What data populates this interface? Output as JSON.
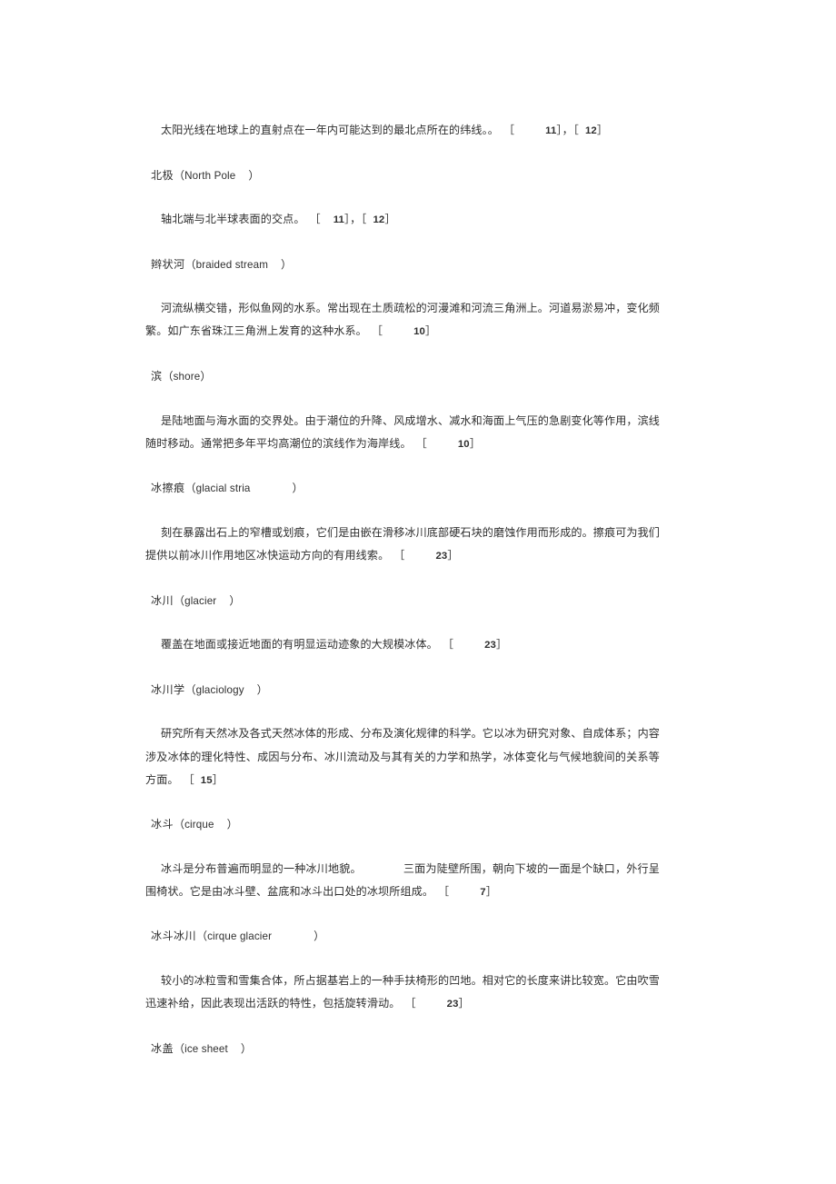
{
  "document": {
    "type": "glossary-page",
    "language": "zh-CN",
    "background_color": "#ffffff",
    "text_color": "#2f2f2f"
  },
  "entries": [
    {
      "id": "entry-tropic-of-cancer-definition",
      "kind": "definition-only",
      "definition": "太阳光线在地球上的直射点在一年内可能达到的最北点所在的纬线。。",
      "citations": [
        "11",
        "12"
      ]
    },
    {
      "id": "entry-north-pole",
      "kind": "term",
      "term_zh": "北极",
      "term_en": "North Pole"
    },
    {
      "id": "entry-north-pole-definition",
      "kind": "definition-only",
      "definition": "轴北端与北半球表面的交点。",
      "citations": [
        "11",
        "12"
      ]
    },
    {
      "id": "entry-braided-stream",
      "kind": "term",
      "term_zh": "辫状河",
      "term_en": "braided stream"
    },
    {
      "id": "entry-braided-stream-definition",
      "kind": "definition-only",
      "definition": "河流纵横交错，形似鱼网的水系。常出现在土质疏松的河漫滩和河流三角洲上。河道易淤易冲，变化频繁。如广东省珠江三角洲上发育的这种水系。",
      "citations": [
        "10"
      ]
    },
    {
      "id": "entry-shore",
      "kind": "term",
      "term_zh": "滨",
      "term_en": "shore"
    },
    {
      "id": "entry-shore-definition",
      "kind": "definition-only",
      "definition": "是陆地面与海水面的交界处。由于潮位的升降、风成增水、减水和海面上气压的急剧变化等作用，滨线随时移动。通常把多年平均高潮位的滨线作为海岸线。",
      "citations": [
        "10"
      ]
    },
    {
      "id": "entry-glacial-stria",
      "kind": "term",
      "term_zh": "冰擦痕",
      "term_en": "glacial stria"
    },
    {
      "id": "entry-glacial-stria-definition",
      "kind": "definition-only",
      "definition": "刻在暴露出石上的窄槽或划痕，它们是由嵌在滑移冰川底部硬石块的磨蚀作用而形成的。擦痕可为我们提供以前冰川作用地区冰快运动方向的有用线索。",
      "citations": [
        "23"
      ]
    },
    {
      "id": "entry-glacier",
      "kind": "term",
      "term_zh": "冰川",
      "term_en": "glacier"
    },
    {
      "id": "entry-glacier-definition",
      "kind": "definition-only",
      "definition": "覆盖在地面或接近地面的有明显运动迹象的大规模冰体。",
      "citations": [
        "23"
      ]
    },
    {
      "id": "entry-glaciology",
      "kind": "term",
      "term_zh": "冰川学",
      "term_en": "glaciology"
    },
    {
      "id": "entry-glaciology-definition",
      "kind": "definition-only",
      "definition": "研究所有天然冰及各式天然冰体的形成、分布及演化规律的科学。它以冰为研究对象、自成体系；内容涉及冰体的理化特性、成因与分布、冰川流动及与其有关的力学和热学，冰体变化与气候地貌间的关系等方面。",
      "citations": [
        "15"
      ]
    },
    {
      "id": "entry-cirque",
      "kind": "term",
      "term_zh": "冰斗",
      "term_en": "cirque"
    },
    {
      "id": "entry-cirque-definition",
      "kind": "definition-only",
      "definition_part1": "冰斗是分布普遍而明显的一种冰川地貌。",
      "definition_part2": "三面为陡壁所围，朝向下坡的一面是个缺口，外行呈围椅状。它是由冰斗壁、盆底和冰斗出口处的冰坝所组成。",
      "citations": [
        "7"
      ]
    },
    {
      "id": "entry-cirque-glacier",
      "kind": "term",
      "term_zh": "冰斗冰川",
      "term_en": "cirque glacier"
    },
    {
      "id": "entry-cirque-glacier-definition",
      "kind": "definition-only",
      "definition": "较小的冰粒雪和雪集合体，所占据基岩上的一种手扶椅形的凹地。相对它的长度来讲比较宽。它由吹雪迅速补给，因此表现出活跃的特性，包括旋转滑动。",
      "citations": [
        "23"
      ]
    },
    {
      "id": "entry-ice-sheet",
      "kind": "term",
      "term_zh": "冰盖",
      "term_en": "ice sheet"
    }
  ],
  "punctuation": {
    "bracket_open": "［",
    "bracket_close": "］",
    "paren_open": "（",
    "paren_close": "）",
    "comma_full": "，"
  }
}
